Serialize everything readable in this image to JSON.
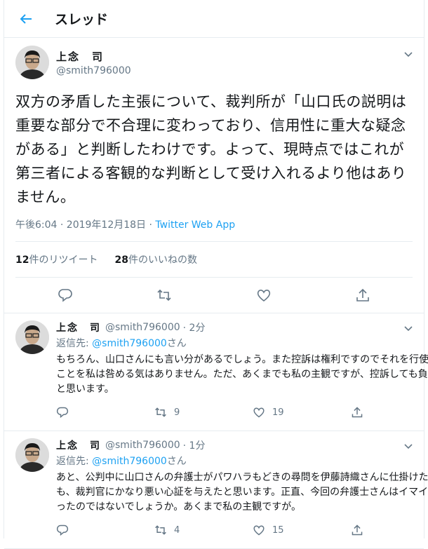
{
  "header": {
    "title": "スレッド"
  },
  "main_tweet": {
    "name": "上念　司",
    "handle": "@smith796000",
    "text": "双方の矛盾した主張について、裁判所が「山口氏の説明は重要な部分で不合理に変わっており、信用性に重大な疑念がある」と判断したわけです。よって、現時点ではこれが第三者による客観的な判断として受け入れるより他はありません。",
    "time": "午後6:04 · 2019年12月18日 · ",
    "source": "Twitter Web App",
    "retweets_count": "12",
    "retweets_label": "件のリツイート",
    "likes_count": "28",
    "likes_label": "件のいいねの数"
  },
  "replies": [
    {
      "name": "上念　司",
      "handle": "@smith796000",
      "time": "· 2分",
      "replying_prefix": "返信先: ",
      "replying_to": "@smith796000",
      "replying_suffix": "さん",
      "text": "もちろん、山口さんにも言い分があるでしょう。また控訴は権利ですのでそれを行使することを私は咎める気はありません。ただ、あくまでも私の主観ですが、控訴しても負けると思います。",
      "retweets": "9",
      "likes": "19"
    },
    {
      "name": "上念　司",
      "handle": "@smith796000",
      "time": "· 1分",
      "replying_prefix": "返信先: ",
      "replying_to": "@smith796000",
      "replying_suffix": "さん",
      "text": "あと、公判中に山口さんの弁護士がパワハラもどきの尋問を伊藤詩織さんに仕掛けたのも、裁判官にかなり悪い心証を与えたと思います。正直、今回の弁護士さんはイマイチだったのではないでしょうか。あくまで私の主観ですが。",
      "retweets": "4",
      "likes": "15"
    }
  ],
  "colors": {
    "accent": "#1da1f2",
    "muted": "#657786",
    "text": "#14171a",
    "border": "#e6ecf0"
  }
}
